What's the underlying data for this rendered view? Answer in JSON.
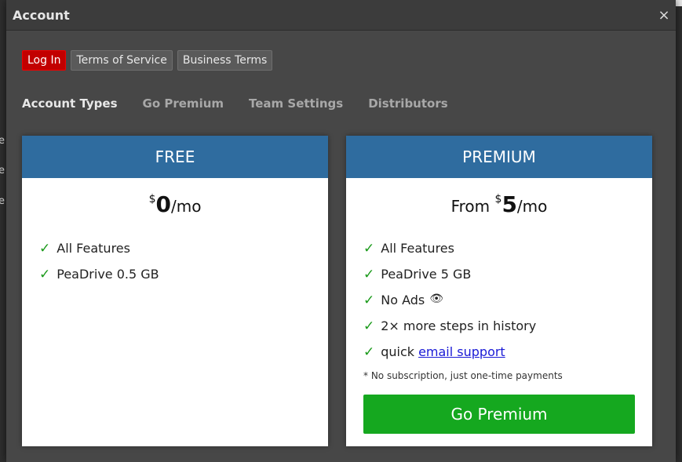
{
  "background": {
    "side_labels": [
      "e",
      "e",
      "e"
    ]
  },
  "dialog": {
    "title": "Account",
    "close_icon": "×"
  },
  "top_buttons": {
    "login": "Log In",
    "terms_of_service": "Terms of Service",
    "business_terms": "Business Terms"
  },
  "tabs": [
    {
      "label": "Account Types",
      "active": true
    },
    {
      "label": "Go Premium",
      "active": false
    },
    {
      "label": "Team Settings",
      "active": false
    },
    {
      "label": "Distributors",
      "active": false
    }
  ],
  "plans": {
    "free": {
      "name": "FREE",
      "price_prefix": "",
      "currency": "$",
      "amount": "0",
      "period": "/mo",
      "features": [
        "All Features",
        "PeaDrive 0.5 GB"
      ]
    },
    "premium": {
      "name": "PREMIUM",
      "price_prefix": "From ",
      "currency": "$",
      "amount": "5",
      "period": "/mo",
      "features": [
        "All Features",
        "PeaDrive 5 GB",
        "No Ads",
        "2× more steps in history"
      ],
      "support_prefix": "quick",
      "support_link": "email support",
      "footnote": "* No subscription, just one-time payments",
      "cta": "Go Premium"
    }
  },
  "icons": {
    "check": "✓",
    "eye": "👁"
  },
  "colors": {
    "login_red": "#c20000",
    "plan_header_blue": "#2f6c9f",
    "cta_green": "#15a81f",
    "check_green": "#1a9a1a",
    "link_blue": "#1a1ad6"
  }
}
